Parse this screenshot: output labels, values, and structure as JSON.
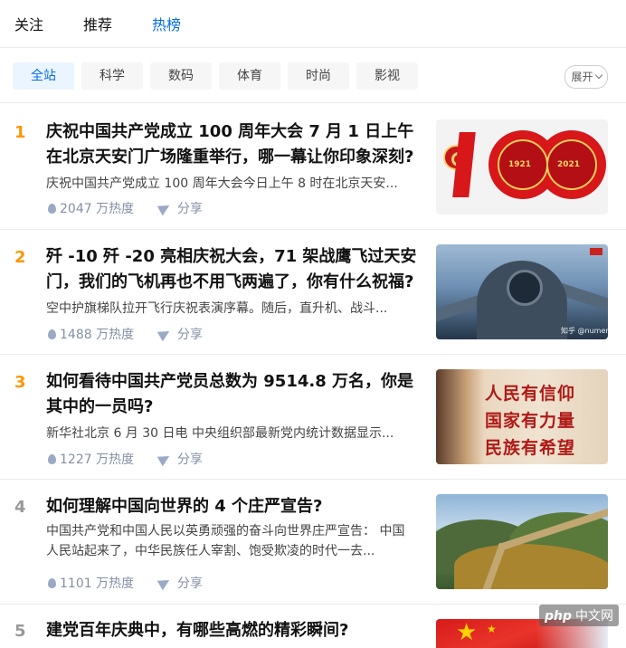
{
  "nav": {
    "tabs": [
      {
        "label": "关注"
      },
      {
        "label": "推荐"
      },
      {
        "label": "热榜"
      }
    ],
    "active": "热榜"
  },
  "categories": [
    {
      "label": "全站"
    },
    {
      "label": "科学"
    },
    {
      "label": "数码"
    },
    {
      "label": "体育"
    },
    {
      "label": "时尚"
    },
    {
      "label": "影视"
    }
  ],
  "expand_label": "展开",
  "colors": {
    "accent": "#056de8",
    "rank_hot": "#ff9607",
    "rank_normal": "#999999",
    "meta": "#8590a6"
  },
  "items": [
    {
      "rank": "1",
      "title": "庆祝中国共产党成立 100 周年大会 7 月 1 日上午在北京天安门广场隆重举行，哪一幕让你印象深刻?",
      "excerpt": "庆祝中国共产党成立 100 周年大会今日上午 8 时在北京天安...",
      "heat": "2047 万热度",
      "share": "分享",
      "thumb": {
        "year_left": "1921",
        "year_right": "2021"
      }
    },
    {
      "rank": "2",
      "title": "歼 -10 歼 -20 亮相庆祝大会，71 架战鹰飞过天安门，我们的飞机再也不用飞两遍了，你有什么祝福?",
      "excerpt": "空中护旗梯队拉开飞行庆祝表演序幕。随后，直升机、战斗...",
      "heat": "1488 万热度",
      "share": "分享",
      "thumb": {
        "watermark": "知乎 @numerical"
      }
    },
    {
      "rank": "3",
      "title": "如何看待中国共产党员总数为 9514.8 万名，你是其中的一员吗?",
      "excerpt": "新华社北京 6 月 30 日电 中央组织部最新党内统计数据显示...",
      "heat": "1227 万热度",
      "share": "分享",
      "thumb": {
        "lines": [
          "人民有信仰",
          "国家有力量",
          "民族有希望"
        ]
      }
    },
    {
      "rank": "4",
      "title": "如何理解中国向世界的 4 个庄严宣告?",
      "excerpt": "中国共产党和中国人民以英勇顽强的奋斗向世界庄严宣告： 中国人民站起来了，中华民族任人宰割、饱受欺凌的时代一去...",
      "heat": "1101 万热度",
      "share": "分享"
    },
    {
      "rank": "5",
      "title": "建党百年庆典中，有哪些高燃的精彩瞬间?"
    }
  ],
  "watermark_badge": {
    "brand": "php",
    "site": "中文网"
  }
}
